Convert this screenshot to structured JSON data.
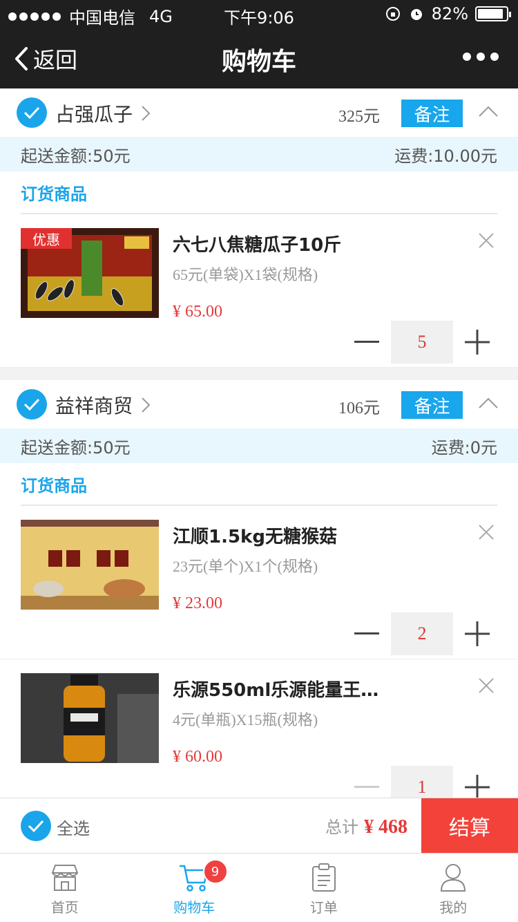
{
  "status_bar": {
    "carrier": "中国电信",
    "network": "4G",
    "time": "下午9:06",
    "battery": "82%",
    "battery_level": 0.82
  },
  "nav": {
    "back_label": "返回",
    "title": "购物车"
  },
  "shops": [
    {
      "name": "占强瓜子",
      "total": "325元",
      "note_label": "备注",
      "min_order": "起送金额:50元",
      "shipping": "运费:10.00元",
      "section_label": "订货商品",
      "items": [
        {
          "promo": "优惠",
          "name": "六七八焦糖瓜子10斤",
          "spec": "65元(单袋)X1袋(规格)",
          "price": "¥ 65.00",
          "qty": "5"
        }
      ]
    },
    {
      "name": "益祥商贸",
      "total": "106元",
      "note_label": "备注",
      "min_order": "起送金额:50元",
      "shipping": "运费:0元",
      "section_label": "订货商品",
      "items": [
        {
          "name": "江顺1.5kg无糖猴菇",
          "spec": "23元(单个)X1个(规格)",
          "price": "¥ 23.00",
          "qty": "2"
        },
        {
          "name": "乐源550ml乐源能量王(…",
          "spec": "4元(单瓶)X15瓶(规格)",
          "price": "¥ 60.00",
          "qty": "1"
        }
      ]
    }
  ],
  "checkout": {
    "select_all": "全选",
    "total_label": "总计",
    "total_amount": "¥ 468",
    "pay_label": "结算"
  },
  "tabs": [
    {
      "label": "首页",
      "icon": "store-icon"
    },
    {
      "label": "购物车",
      "icon": "cart-icon",
      "badge": "9"
    },
    {
      "label": "订单",
      "icon": "clipboard-icon"
    },
    {
      "label": "我的",
      "icon": "user-icon"
    }
  ],
  "colors": {
    "accent": "#1aa5ea",
    "price_red": "#e33a3a",
    "pay_button": "#f2423a",
    "header_bg": "#1f1f1f"
  }
}
